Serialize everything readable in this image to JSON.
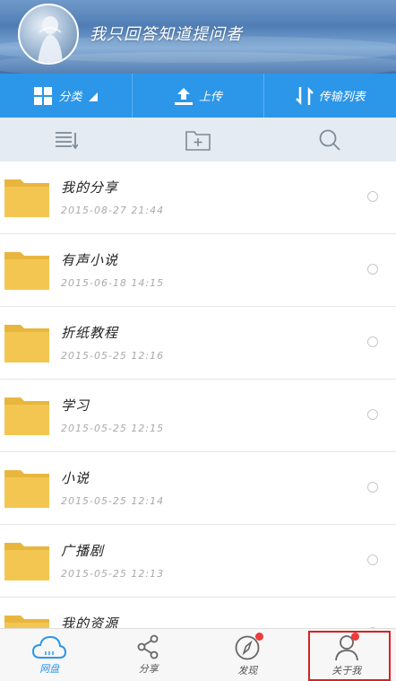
{
  "header": {
    "username": "我只回答知道提问者"
  },
  "actions": [
    {
      "label": "分类",
      "icon": "grid-icon"
    },
    {
      "label": "上传",
      "icon": "upload-icon"
    },
    {
      "label": "传输列表",
      "icon": "transfer-icon"
    }
  ],
  "toolbar": {
    "icons": [
      "sort-icon",
      "new-folder-icon",
      "search-icon"
    ]
  },
  "files": [
    {
      "name": "我的分享",
      "date": "2015-08-27 21:44"
    },
    {
      "name": "有声小说",
      "date": "2015-06-18 14:15"
    },
    {
      "name": "折纸教程",
      "date": "2015-05-25 12:16"
    },
    {
      "name": "学习",
      "date": "2015-05-25 12:15"
    },
    {
      "name": "小说",
      "date": "2015-05-25 12:14"
    },
    {
      "name": "广播剧",
      "date": "2015-05-25 12:13"
    },
    {
      "name": "我的资源",
      "date": ""
    }
  ],
  "bottom_nav": [
    {
      "label": "网盘",
      "icon": "cloud-icon",
      "active": true
    },
    {
      "label": "分享",
      "icon": "share-icon",
      "active": false
    },
    {
      "label": "发现",
      "icon": "compass-icon",
      "active": false
    },
    {
      "label": "关于我",
      "icon": "person-icon",
      "active": false
    }
  ],
  "colors": {
    "accent": "#2c96e8",
    "folder": "#f2c14e",
    "badge": "#ee3b3b"
  }
}
